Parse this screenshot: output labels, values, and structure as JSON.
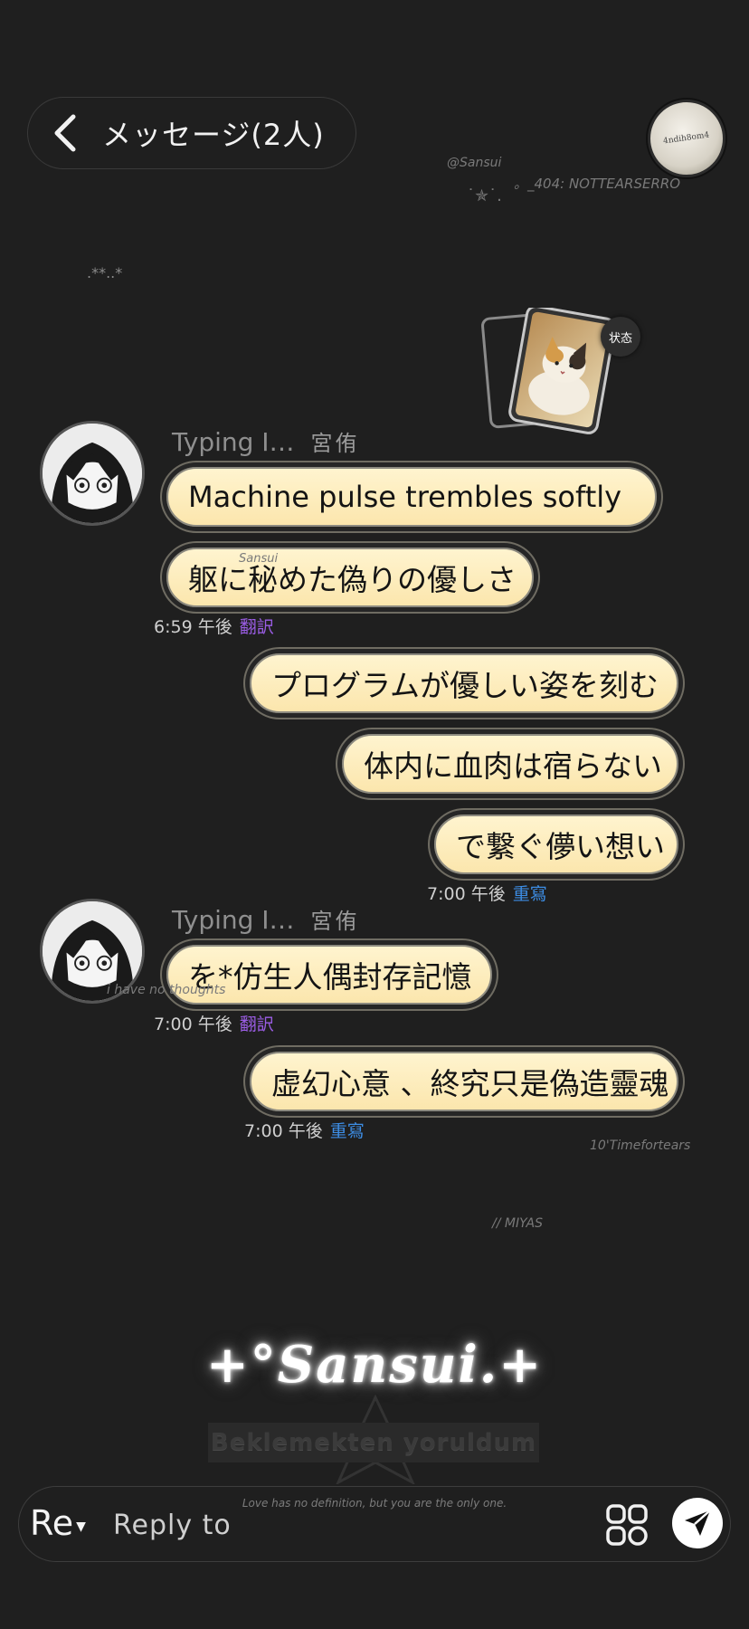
{
  "header": {
    "title": "メッセージ(2人)",
    "back_icon": "chevron-left-icon",
    "avatar_text": "4ndih8om4"
  },
  "watermarks": {
    "handle": "@Sansui",
    "star_deco": "˙✯˙.",
    "code_tag": "。_404:  NOTTEARSERRO",
    "sparkle": ".**..*",
    "time_tag": "10'Timefortears",
    "miyas": "//    MIYAS",
    "thoughts": "i have no thoughts",
    "bubble_wm": "Sansui"
  },
  "status_badge": "状态",
  "sender": {
    "typing": "Typing I…",
    "name": "宮侑"
  },
  "messages": [
    {
      "text": "Machine pulse trembles softly"
    },
    {
      "text": "躯に秘めた偽りの優しさ"
    },
    {
      "meta_time": "6:59 午後",
      "action": "翻訳"
    },
    {
      "text": "プログラムが優しい姿を刻む"
    },
    {
      "text": "体内に血肉は宿らない"
    },
    {
      "text": "で繋ぐ儚い想い"
    },
    {
      "meta_time": "7:00 午後",
      "action": "重寫"
    },
    {
      "text": "を*仿生人偶封存記憶"
    },
    {
      "meta_time": "7:00 午後",
      "action": "翻訳"
    },
    {
      "text": "虚幻心意 、終究只是偽造靈魂"
    },
    {
      "meta_time": "7:00 午後",
      "action": "重寫"
    }
  ],
  "brand": {
    "name": "+°Sansui.+",
    "tagline": "Beklemekten yoruldum",
    "footnote": "Love has no definition, but you are the only one."
  },
  "composer": {
    "reply_mode": "Re",
    "placeholder": "Reply to",
    "apps_icon": "apps-grid-icon",
    "send_icon": "send-icon"
  },
  "colors": {
    "background": "#1f1f1f",
    "bubble": "#fdf0c4",
    "bubble_accent": "#f2c86b",
    "translate_link": "#9b5de5",
    "rewrite_link": "#3d8ee6"
  }
}
